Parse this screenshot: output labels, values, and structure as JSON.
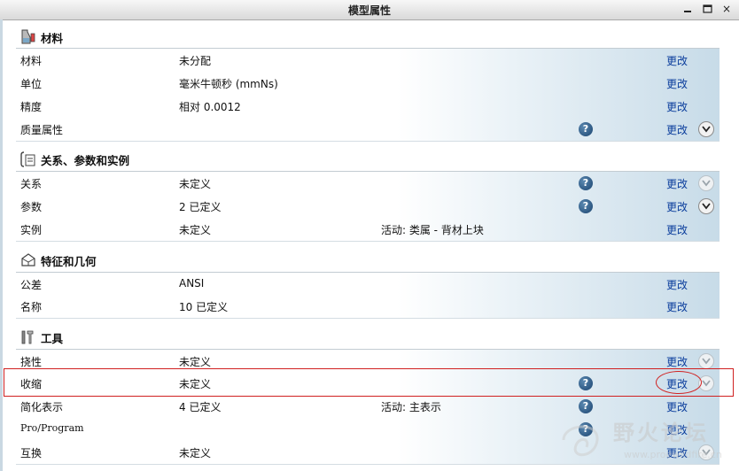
{
  "window": {
    "title": "模型属性",
    "buttons": [
      "minimize",
      "restore",
      "close"
    ],
    "close_glyph": "×"
  },
  "colors": {
    "link": "#0a3d9c",
    "highlight": "#d02020",
    "row_gradient_end": "#c7dbe8"
  },
  "sections": [
    {
      "title": "材料",
      "icon": "material-flask-icon"
    },
    {
      "title": "关系、参数和实例",
      "icon": "relations-icon"
    },
    {
      "title": "特征和几何",
      "icon": "feature-geometry-icon"
    },
    {
      "title": "工具",
      "icon": "tools-icon"
    }
  ],
  "rows": {
    "material": {
      "name": "材料",
      "value": "未分配",
      "action": "更改"
    },
    "units": {
      "name": "单位",
      "value": "毫米牛顿秒 (mmNs)",
      "action": "更改"
    },
    "accuracy": {
      "name": "精度",
      "value": "相对 0.0012",
      "action": "更改"
    },
    "mass": {
      "name": "质量属性",
      "value": "",
      "action": "更改"
    },
    "relations": {
      "name": "关系",
      "value": "未定义",
      "action": "更改"
    },
    "parameters": {
      "name": "参数",
      "value": "2 已定义",
      "action": "更改"
    },
    "instances": {
      "name": "实例",
      "value": "未定义",
      "extra": "活动: 类属 - 背材上块",
      "action": "更改"
    },
    "tolerance": {
      "name": "公差",
      "value": "ANSI",
      "action": "更改"
    },
    "names": {
      "name": "名称",
      "value": "10 已定义",
      "action": "更改"
    },
    "flexibility": {
      "name": "挠性",
      "value": "未定义",
      "action": "更改"
    },
    "shrinkage": {
      "name": "收缩",
      "value": "未定义",
      "action": "更改"
    },
    "simplified": {
      "name": "简化表示",
      "value": "4 已定义",
      "extra": "活动: 主表示",
      "action": "更改"
    },
    "program": {
      "name": "Pro/Program",
      "value": "",
      "action": "更改"
    },
    "interchange": {
      "name": "互换",
      "value": "未定义",
      "action": "更改"
    }
  },
  "watermark": {
    "text": "野火论坛",
    "url": "www.proewildfire.cn"
  }
}
